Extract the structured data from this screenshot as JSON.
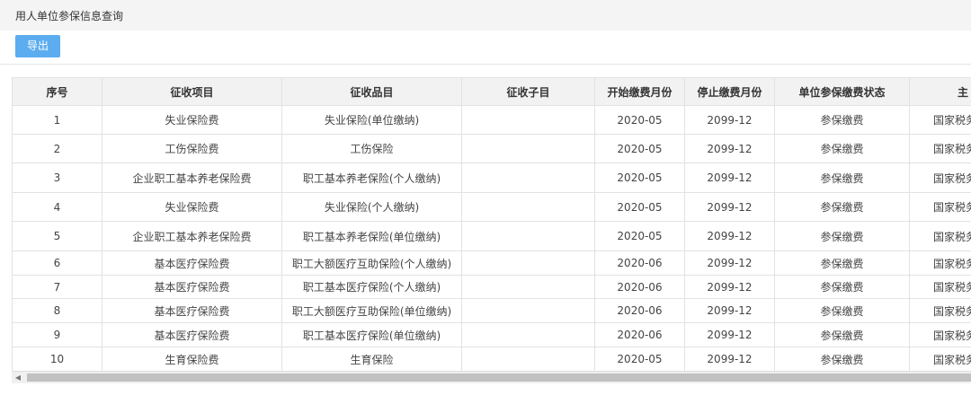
{
  "page": {
    "title": "用人单位参保信息查询"
  },
  "toolbar": {
    "export_label": "导出"
  },
  "table": {
    "headers": [
      "序号",
      "征收项目",
      "征收品目",
      "征收子目",
      "开始缴费月份",
      "停止缴费月份",
      "单位参保缴费状态",
      "主"
    ],
    "rows": [
      [
        "1",
        "失业保险费",
        "失业保险(单位缴纳)",
        "",
        "2020-05",
        "2099-12",
        "参保缴费",
        "国家税务"
      ],
      [
        "2",
        "工伤保险费",
        "工伤保险",
        "",
        "2020-05",
        "2099-12",
        "参保缴费",
        "国家税务"
      ],
      [
        "3",
        "企业职工基本养老保险费",
        "职工基本养老保险(个人缴纳)",
        "",
        "2020-05",
        "2099-12",
        "参保缴费",
        "国家税务"
      ],
      [
        "4",
        "失业保险费",
        "失业保险(个人缴纳)",
        "",
        "2020-05",
        "2099-12",
        "参保缴费",
        "国家税务"
      ],
      [
        "5",
        "企业职工基本养老保险费",
        "职工基本养老保险(单位缴纳)",
        "",
        "2020-05",
        "2099-12",
        "参保缴费",
        "国家税务"
      ],
      [
        "6",
        "基本医疗保险费",
        "职工大额医疗互助保险(个人缴纳)",
        "",
        "2020-06",
        "2099-12",
        "参保缴费",
        "国家税务"
      ],
      [
        "7",
        "基本医疗保险费",
        "职工基本医疗保险(个人缴纳)",
        "",
        "2020-06",
        "2099-12",
        "参保缴费",
        "国家税务"
      ],
      [
        "8",
        "基本医疗保险费",
        "职工大额医疗互助保险(单位缴纳)",
        "",
        "2020-06",
        "2099-12",
        "参保缴费",
        "国家税务"
      ],
      [
        "9",
        "基本医疗保险费",
        "职工基本医疗保险(单位缴纳)",
        "",
        "2020-06",
        "2099-12",
        "参保缴费",
        "国家税务"
      ],
      [
        "10",
        "生育保险费",
        "生育保险",
        "",
        "2020-05",
        "2099-12",
        "参保缴费",
        "国家税务"
      ]
    ]
  },
  "colors": {
    "accent": "#5cadf0",
    "header_bg": "#f4f4f4",
    "table_header_bg": "#f2f2f2"
  }
}
